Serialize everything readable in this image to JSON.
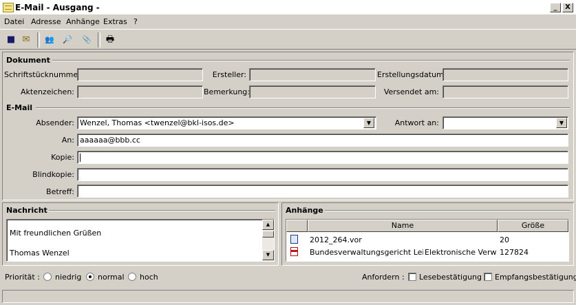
{
  "window": {
    "title": "E-Mail - Ausgang -",
    "minimize_glyph": "_",
    "close_glyph": "X"
  },
  "menu": [
    "Datei",
    "Adresse",
    "Anhänge",
    "Extras",
    "?"
  ],
  "toolbar": {
    "icons": [
      "save-icon",
      "open-mail-icon",
      "address-book-icon",
      "search-address-icon",
      "attach-icon",
      "print-icon"
    ],
    "glyphs": [
      "■",
      "✉",
      "👥",
      "🔎",
      "📎",
      "🖶"
    ]
  },
  "dokument": {
    "heading": "Dokument",
    "labels": {
      "schriftstuecknummer": "Schriftstücknummer:",
      "ersteller": "Ersteller:",
      "erstellungsdatum": "Erstellungsdatum:",
      "aktenzeichen": "Aktenzeichen:",
      "bemerkung": "Bemerkung:",
      "versendet_am": "Versendet am:"
    }
  },
  "email": {
    "heading": "E-Mail",
    "labels": {
      "absender": "Absender:",
      "antwort_an": "Antwort an:",
      "an": "An:",
      "kopie": "Kopie:",
      "blindkopie": "Blindkopie:",
      "betreff": "Betreff:"
    },
    "values": {
      "absender": "Wenzel, Thomas <twenzel@bkl-isos.de>",
      "an": "aaaaaa@bbb.cc"
    }
  },
  "nachricht": {
    "heading": "Nachricht",
    "lines": [
      "Mit freundlichen Grüßen",
      "Thomas Wenzel"
    ]
  },
  "anhaenge": {
    "heading": "Anhänge",
    "columns": [
      "Name",
      "Größe"
    ],
    "rows": [
      {
        "icon": "file-icon",
        "name": "2012_264.vor",
        "extra": "",
        "size": "20"
      },
      {
        "icon": "pdf-icon",
        "name": "Bundesverwaltungsgericht Leipzig",
        "extra": "Elektronische Verwaltu",
        "size": "127824"
      }
    ]
  },
  "prioritaet": {
    "label": "Priorität :",
    "options": [
      "niedrig",
      "normal",
      "hoch"
    ],
    "selected": "normal"
  },
  "anfordern": {
    "label": "Anfordern :",
    "options": [
      "Lesebestätigung",
      "Empfangsbestätigung"
    ]
  }
}
